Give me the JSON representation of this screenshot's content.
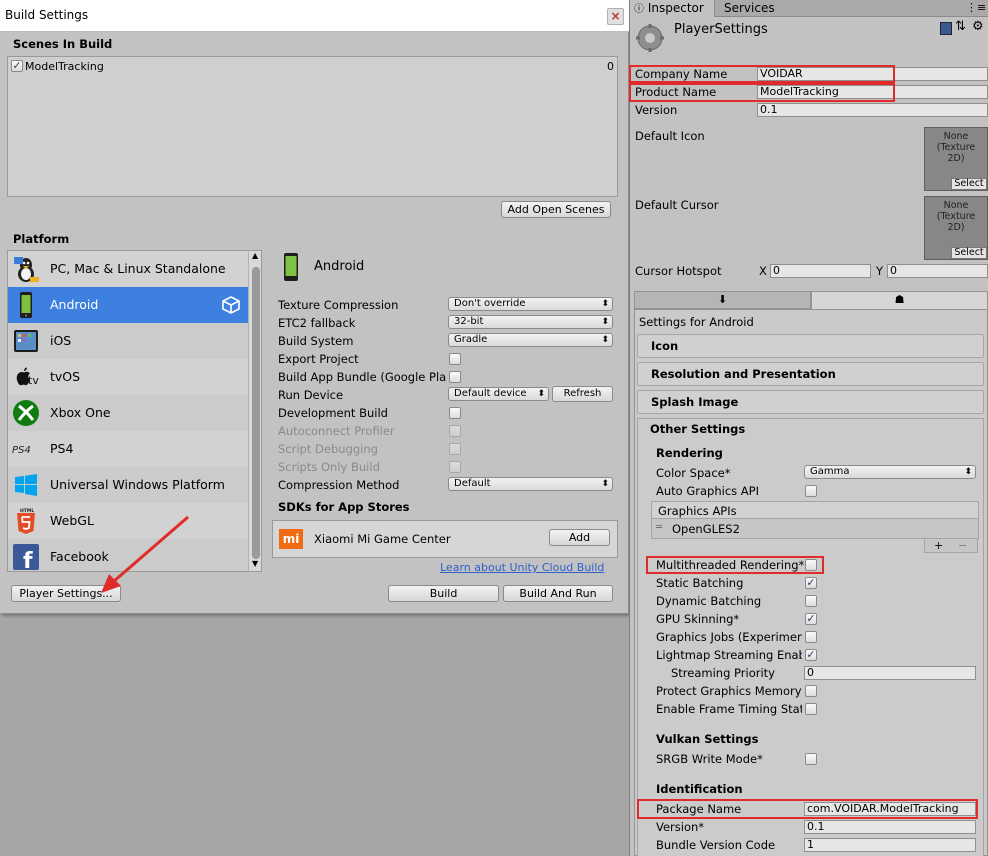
{
  "build_window": {
    "title": "Build Settings",
    "close_label": "×",
    "scenes_title": "Scenes In Build",
    "scene": {
      "name": "ModelTracking",
      "index": "0",
      "checked": true
    },
    "add_open_scenes": "Add Open Scenes",
    "platform_title": "Platform",
    "platforms": [
      {
        "label": "PC, Mac & Linux Standalone",
        "icon": "penguin-icon"
      },
      {
        "label": "Android",
        "icon": "android-phone-icon",
        "selected": true
      },
      {
        "label": "iOS",
        "icon": "ipad-icon"
      },
      {
        "label": "tvOS",
        "icon": "apple-tv-icon",
        "brand": "tv"
      },
      {
        "label": "Xbox One",
        "icon": "xbox-icon"
      },
      {
        "label": "PS4",
        "icon": "ps4-icon",
        "brand": "PS4"
      },
      {
        "label": "Universal Windows Platform",
        "icon": "windows-icon"
      },
      {
        "label": "WebGL",
        "icon": "html5-icon",
        "brand": "HTML"
      },
      {
        "label": "Facebook",
        "icon": "facebook-icon",
        "brand": "f"
      }
    ],
    "android_header": "Android",
    "settings": {
      "texture_compression": {
        "label": "Texture Compression",
        "value": "Don't override"
      },
      "etc2_fallback": {
        "label": "ETC2 fallback",
        "value": "32-bit"
      },
      "build_system": {
        "label": "Build System",
        "value": "Gradle"
      },
      "export_project": "Export Project",
      "build_app_bundle": "Build App Bundle (Google Play)",
      "run_device": {
        "label": "Run Device",
        "value": "Default device"
      },
      "refresh": "Refresh",
      "development_build": "Development Build",
      "autoconnect_profiler": "Autoconnect Profiler",
      "script_debugging": "Script Debugging",
      "scripts_only_build": "Scripts Only Build",
      "compression_method": {
        "label": "Compression Method",
        "value": "Default"
      }
    },
    "sdk_title": "SDKs for App Stores",
    "sdk": {
      "name": "Xiaomi Mi Game Center",
      "logo": "mi",
      "add": "Add"
    },
    "cloud_link": "Learn about Unity Cloud Build",
    "player_settings": "Player Settings...",
    "build": "Build",
    "build_and_run": "Build And Run"
  },
  "inspector": {
    "tabs": [
      "Inspector",
      "Services"
    ],
    "title": "PlayerSettings",
    "company_name": {
      "label": "Company Name",
      "value": "VOIDAR"
    },
    "product_name": {
      "label": "Product Name",
      "value": "ModelTracking"
    },
    "version": {
      "label": "Version",
      "value": "0.1"
    },
    "default_icon": "Default Icon",
    "default_cursor": "Default Cursor",
    "texture_none": "None\n(Texture\n2D)",
    "select": "Select",
    "cursor_hotspot": {
      "label": "Cursor Hotspot",
      "x_label": "X",
      "x": "0",
      "y_label": "Y",
      "y": "0"
    },
    "settings_for": "Settings for Android",
    "sections": [
      "Icon",
      "Resolution and Presentation",
      "Splash Image",
      "Other Settings"
    ],
    "rendering": {
      "title": "Rendering",
      "color_space": {
        "label": "Color Space*",
        "value": "Gamma"
      },
      "auto_graphics_api": "Auto Graphics API",
      "graphics_apis": "Graphics APIs",
      "api_item": "OpenGLES2",
      "plus": "+",
      "minus": "−",
      "multithreaded": "Multithreaded Rendering*",
      "static_batching": "Static Batching",
      "dynamic_batching": "Dynamic Batching",
      "gpu_skinning": "GPU Skinning*",
      "graphics_jobs": "Graphics Jobs (Experimental)*",
      "lightmap_streaming": "Lightmap Streaming Enabled",
      "streaming_priority": {
        "label": "Streaming Priority",
        "value": "0"
      },
      "protect_graphics": "Protect Graphics Memory",
      "frame_timing": "Enable Frame Timing Stats"
    },
    "vulkan": {
      "title": "Vulkan Settings",
      "srgb": "SRGB Write Mode*"
    },
    "identification": {
      "title": "Identification",
      "package_name": {
        "label": "Package Name",
        "value": "com.VOIDAR.ModelTracking"
      },
      "version": {
        "label": "Version*",
        "value": "0.1"
      },
      "bundle_code": {
        "label": "Bundle Version Code",
        "value": "1"
      }
    }
  },
  "colors": {
    "accent": "#3d80df",
    "highlight": "#e02b2b",
    "link": "#3060c8"
  }
}
